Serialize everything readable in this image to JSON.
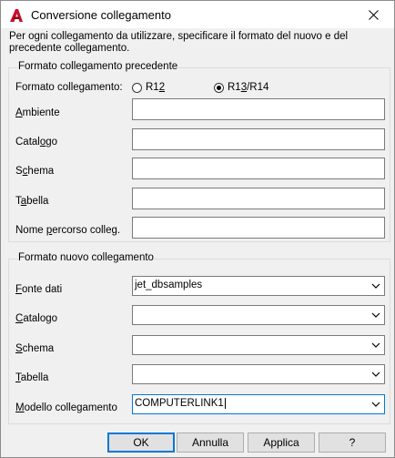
{
  "window": {
    "title": "Conversione collegamento",
    "app_icon": "autocad-logo-icon",
    "close_glyph": "✕"
  },
  "instructions": "Per ogni collegamento da utilizzare, specificare il formato del nuovo e del precedente collegamento.",
  "old_link": {
    "group_title": "Formato collegamento precedente",
    "format_label": "Formato collegamento:",
    "radio_r12": {
      "pre": "R1",
      "ul": "2",
      "post": "",
      "selected": false
    },
    "radio_r13": {
      "pre": "R1",
      "ul": "3",
      "post": "/R14",
      "selected": true
    },
    "fields": [
      {
        "pre": "",
        "ul": "A",
        "post": "mbiente",
        "value": ""
      },
      {
        "pre": "Catal",
        "ul": "o",
        "post": "go",
        "value": ""
      },
      {
        "pre": "S",
        "ul": "c",
        "post": "hema",
        "value": ""
      },
      {
        "pre": "T",
        "ul": "a",
        "post": "bella",
        "value": ""
      },
      {
        "pre": "Nome ",
        "ul": "p",
        "post": "ercorso colleg.",
        "value": ""
      }
    ]
  },
  "new_link": {
    "group_title": "Formato nuovo collegamento",
    "fields": [
      {
        "pre": "",
        "ul": "F",
        "post": "onte dati",
        "value": "jet_dbsamples"
      },
      {
        "pre": "",
        "ul": "C",
        "post": "atalogo",
        "value": ""
      },
      {
        "pre": "",
        "ul": "S",
        "post": "chema",
        "value": ""
      },
      {
        "pre": "",
        "ul": "T",
        "post": "abella",
        "value": ""
      },
      {
        "pre": "",
        "ul": "M",
        "post": "odello collegamento",
        "value": "COMPUTERLINK1"
      }
    ]
  },
  "buttons": {
    "ok": "OK",
    "cancel": "Annulla",
    "apply": "Applica",
    "help": "?"
  },
  "colors": {
    "accent": "#0078d7",
    "logo_red": "#c8102e"
  }
}
